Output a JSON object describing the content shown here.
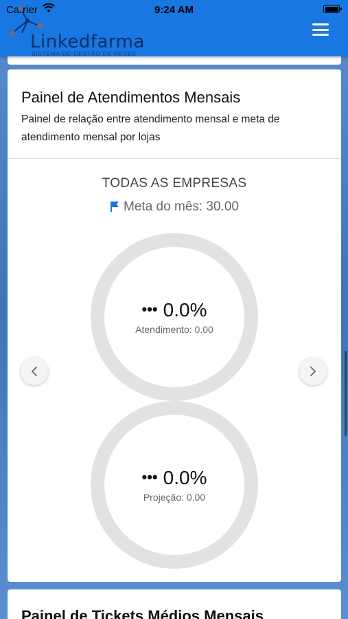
{
  "status": {
    "carrier": "Carrier",
    "time": "9:24 AM"
  },
  "header": {
    "brand": "Linkedfarma",
    "tagline": "SISTEMA DE GESTÃO DE REDES",
    "menu_icon": "hamburger-icon",
    "color": "#1877e0"
  },
  "panel": {
    "title": "Painel de Atendimentos Mensais",
    "description": "Painel de relação entre atendimento mensal e meta de atendimento mensal por lojas",
    "company": "TODAS AS EMPRESAS",
    "meta_label": "Meta do mês: 30.00",
    "flag_color": "#1877e0",
    "ring_color": "#e2e2e2",
    "gauges": [
      {
        "dots": "•••",
        "value": "0.0%",
        "label": "Atendimento: 0.00"
      },
      {
        "dots": "•••",
        "value": "0.0%",
        "label": "Projeção: 0.00"
      }
    ],
    "prev_icon": "chevron-left-icon",
    "next_icon": "chevron-right-icon"
  },
  "next_panel": {
    "title": "Painel de Tickets Médios Mensais"
  }
}
